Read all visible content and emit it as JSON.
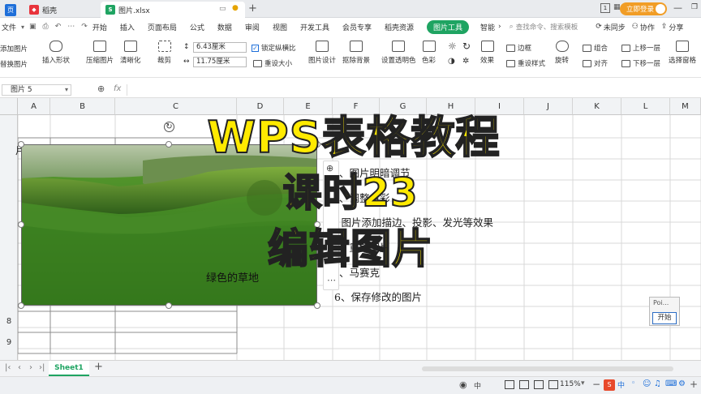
{
  "tabs": [
    {
      "label": "页"
    },
    {
      "label": "稻壳"
    },
    {
      "label": "图片.xlsx"
    }
  ],
  "window": {
    "new_tab": "+",
    "login_label": "立即登录",
    "num_badge": "1"
  },
  "menu": {
    "file": "文件",
    "items": [
      "开始",
      "插入",
      "页面布局",
      "公式",
      "数据",
      "审阅",
      "视图",
      "开发工具",
      "会员专享",
      "稻壳资源"
    ],
    "picture_tools": "图片工具",
    "smart": "智能",
    "search_placeholder": "查找命令、搜索模板",
    "unsync": "未同步",
    "collab": "协作",
    "share": "分享"
  },
  "ribbon": {
    "add_picture": "添加图片",
    "replace_picture": "替换图片",
    "insert_shape": "插入形状",
    "compress": "压缩图片",
    "clarify": "清晰化",
    "crop": "裁剪",
    "height": "6.43厘米",
    "width": "11.75厘米",
    "lock_ratio": "锁定纵横比",
    "reset_size": "重设大小",
    "picture_design": "图片设计",
    "remove_bg": "抠除背景",
    "set_transparent": "设置透明色",
    "color": "色彩",
    "effects": "效果",
    "border": "边框",
    "reset_style": "重设样式",
    "rotate": "旋转",
    "group": "组合",
    "align": "对齐",
    "bring_forward": "上移一层",
    "send_backward": "下移一层",
    "selection_pane": "选择窗格"
  },
  "formula_bar": {
    "name_box": "图片 5",
    "fx": "fx"
  },
  "grid": {
    "columns": [
      "A",
      "B",
      "C",
      "D",
      "E",
      "F",
      "G",
      "H",
      "I",
      "J",
      "K",
      "L",
      "M"
    ],
    "rows": [
      "8",
      "9"
    ],
    "partial_cell": "片"
  },
  "picture_caption": "绿色的草地",
  "list_items": [
    "1、图片明暗调节",
    "2、调整色彩",
    "3、图片添加描边、投影、发光等效果",
    "4、重置图片",
    "5、马赛克",
    "6、保存修改的图片"
  ],
  "overlay_title": [
    "WPS表格教程",
    "课时23",
    "编辑图片"
  ],
  "popup": {
    "title": "Poi...",
    "start_button": "开始"
  },
  "sheets": [
    {
      "name": "Sheet1"
    }
  ],
  "sheet_add": "+",
  "status": {
    "zoom": "115%",
    "ime": "中"
  },
  "colors": {
    "accent_green": "#1fa462",
    "login_orange": "#f19d26",
    "overlay_yellow": "#ffea00"
  }
}
